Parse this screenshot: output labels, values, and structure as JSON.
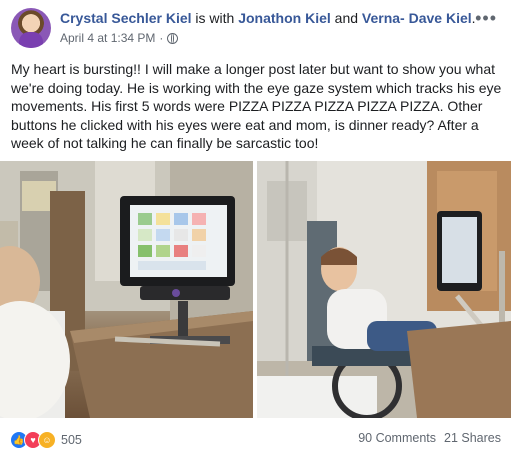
{
  "post": {
    "author": "Crystal Sechler Kiel",
    "with_text": " is with ",
    "tagged_1": "Jonathon Kiel",
    "and_text": " and ",
    "tagged_2": "Verna- Dave Kiel",
    "period": ".",
    "timestamp": "April 4 at 1:34 PM",
    "separator": "·",
    "more_label": "•••",
    "text": "My heart is bursting!! I will make a longer post later but want to show you what we're doing today. He is working with the eye gaze system which tracks his eye movements. His first 5 words were PIZZA PIZZA PIZZA PIZZA PIZZA. Other buttons he clicked with his eyes were eat and mom, is dinner ready? After a week of not talking he can finally be sarcastic too!"
  },
  "footer": {
    "reactions": [
      "like-icon",
      "love-icon",
      "haha-icon"
    ],
    "reaction_count": "505",
    "comments": "90 Comments",
    "shares": "21 Shares"
  },
  "colors": {
    "link": "#385898",
    "meta": "#606770",
    "like": "#2078f4",
    "love": "#f33e58",
    "haha": "#f7b125"
  }
}
